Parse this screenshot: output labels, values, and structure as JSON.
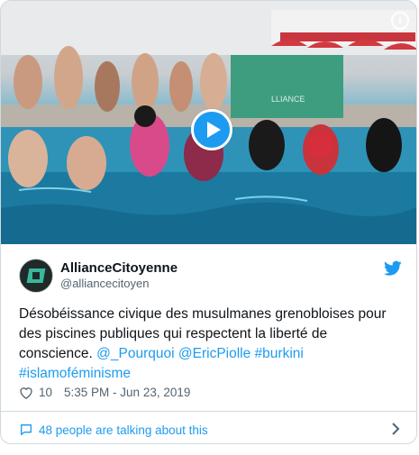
{
  "media": {
    "type": "video-thumbnail",
    "info_icon": "info-icon",
    "play_icon": "play-icon"
  },
  "author": {
    "name": "AllianceCitoyenne",
    "handle": "@alliancecitoyen",
    "platform_icon": "twitter-bird-icon"
  },
  "tweet": {
    "text": "Désobéissance civique des musulmanes grenobloises pour des piscines publiques qui respectent la liberté de conscience.",
    "mentions": [
      "@_Pourquoi",
      "@EricPiolle"
    ],
    "hashtags": [
      "#burkini",
      "#islamoféminisme"
    ]
  },
  "stats": {
    "likes": "10",
    "timestamp": "5:35 PM - Jun 23, 2019"
  },
  "footer": {
    "talking": "48 people are talking about this"
  },
  "colors": {
    "link": "#1d9bf0",
    "text": "#0f1419",
    "muted": "#536471",
    "border": "#cfd9de"
  }
}
